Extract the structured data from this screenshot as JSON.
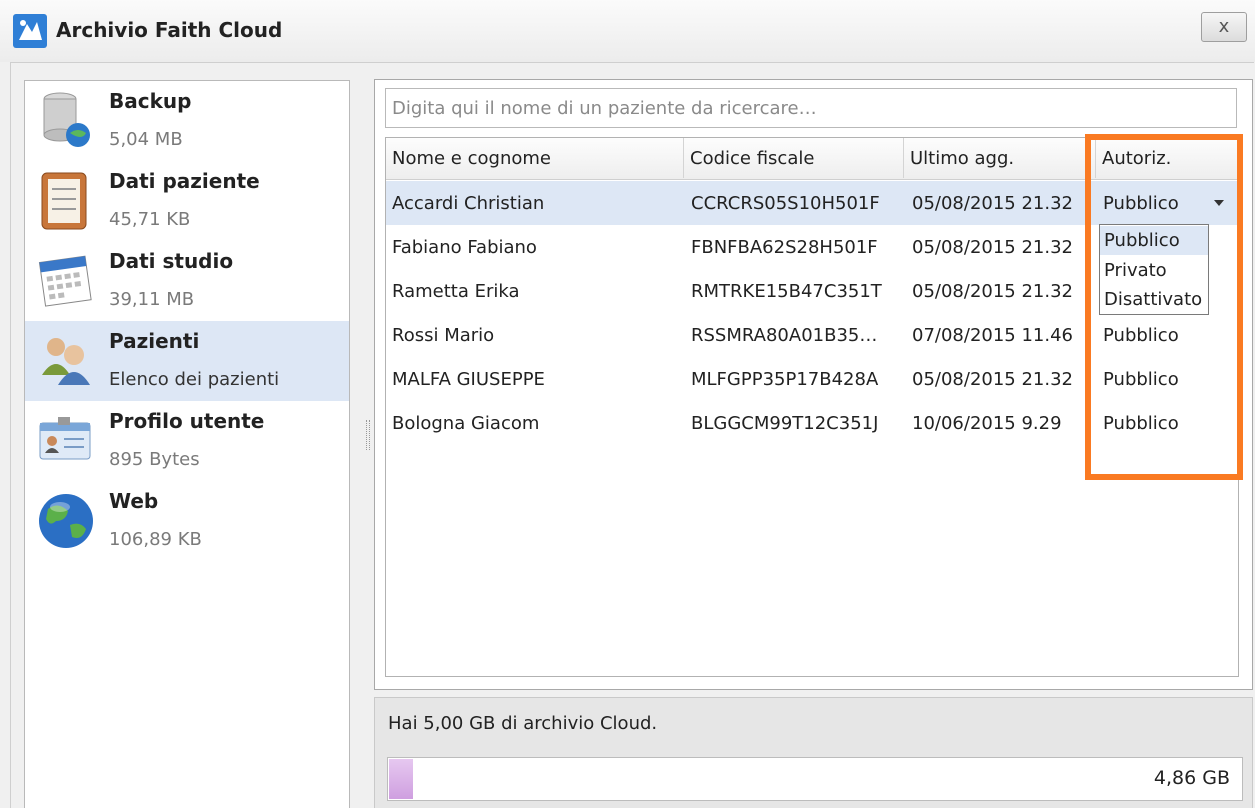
{
  "window": {
    "title": "Archivio Faith Cloud",
    "close_label": "x"
  },
  "sidebar": {
    "items": [
      {
        "title": "Backup",
        "subtitle": "5,04 MB",
        "icon": "database-globe-icon"
      },
      {
        "title": "Dati paziente",
        "subtitle": "45,71 KB",
        "icon": "clipboard-icon"
      },
      {
        "title": "Dati studio",
        "subtitle": "39,11 MB",
        "icon": "calendar-icon"
      },
      {
        "title": "Pazienti",
        "subtitle": "Elenco dei pazienti",
        "icon": "people-icon",
        "selected": true
      },
      {
        "title": "Profilo utente",
        "subtitle": "895 Bytes",
        "icon": "id-card-icon"
      },
      {
        "title": "Web",
        "subtitle": "106,89 KB",
        "icon": "globe-icon"
      }
    ]
  },
  "search": {
    "placeholder": "Digita qui il nome di un paziente da ricercare…"
  },
  "table": {
    "columns": [
      "Nome e cognome",
      "Codice fiscale",
      "Ultimo agg.",
      "Autoriz."
    ],
    "rows": [
      {
        "name": "Accardi Christian",
        "cf": "CCRCRS05S10H501F",
        "updated": "05/08/2015 21.32",
        "auth": "Pubblico"
      },
      {
        "name": "Fabiano Fabiano",
        "cf": "FBNFBA62S28H501F",
        "updated": "05/08/2015 21.32",
        "auth": ""
      },
      {
        "name": "Rametta Erika",
        "cf": "RMTRKE15B47C351T",
        "updated": "05/08/2015 21.32",
        "auth": ""
      },
      {
        "name": "Rossi Mario",
        "cf": "RSSMRA80A01B35…",
        "updated": "07/08/2015 11.46",
        "auth": "Pubblico"
      },
      {
        "name": "MALFA GIUSEPPE",
        "cf": "MLFGPP35P17B428A",
        "updated": "05/08/2015 21.32",
        "auth": "Pubblico"
      },
      {
        "name": "Bologna Giacom",
        "cf": "BLGGCM99T12C351J",
        "updated": "10/06/2015 9.29",
        "auth": "Pubblico"
      }
    ]
  },
  "auth_dropdown": {
    "selected": "Pubblico",
    "options": [
      "Pubblico",
      "Privato",
      "Disattivato"
    ]
  },
  "storage": {
    "info": "Hai 5,00 GB di archivio Cloud.",
    "free_label": "4,86 GB",
    "used_fraction": 0.028,
    "fill_color": "#cf9fe0"
  },
  "colors": {
    "highlight_border": "#fa7a22",
    "selection": "#dde7f5"
  }
}
